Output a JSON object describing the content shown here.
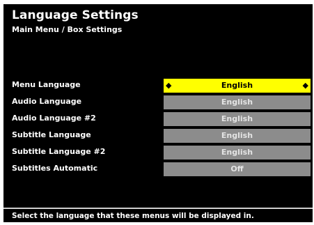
{
  "header": {
    "title": "Language Settings",
    "breadcrumb": "Main Menu / Box Settings"
  },
  "settings": [
    {
      "label": "Menu Language",
      "value": "English",
      "selected": true
    },
    {
      "label": "Audio Language",
      "value": "English",
      "selected": false
    },
    {
      "label": "Audio Language #2",
      "value": "English",
      "selected": false
    },
    {
      "label": "Subtitle Language",
      "value": "English",
      "selected": false
    },
    {
      "label": "Subtitle Language #2",
      "value": "English",
      "selected": false
    },
    {
      "label": "Subtitles Automatic",
      "value": "Off",
      "selected": false
    }
  ],
  "selector_arrows": {
    "left_icon": "arrow-left-icon",
    "right_icon": "arrow-right-icon"
  },
  "footer": {
    "hint": "Select the language that these menus will be displayed in."
  },
  "colors": {
    "background": "#000000",
    "selected": "#ffff00",
    "unselected": "#8c8c8c"
  }
}
